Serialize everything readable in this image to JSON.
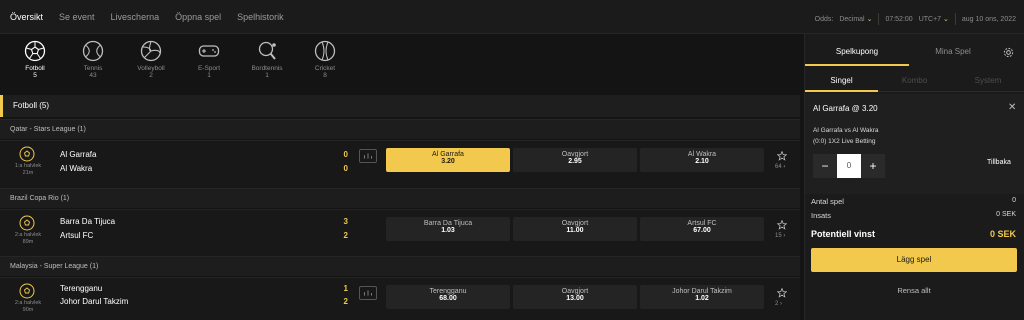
{
  "nav": [
    "Översikt",
    "Se event",
    "Livescherna",
    "Öppna spel",
    "Spelhistorik"
  ],
  "topbar": {
    "odds_label": "Odds:",
    "odds_value": "Decimal",
    "time": "07:52:00",
    "timezone": "UTC+7",
    "date": "aug 10 ons, 2022"
  },
  "sports": [
    {
      "name": "Fotboll",
      "count": "5",
      "icon": "football-icon"
    },
    {
      "name": "Tennis",
      "count": "43",
      "icon": "tennis-icon"
    },
    {
      "name": "Volleyboll",
      "count": "2",
      "icon": "volleyball-icon"
    },
    {
      "name": "E-Sport",
      "count": "1",
      "icon": "gamepad-icon"
    },
    {
      "name": "Bordtennis",
      "count": "1",
      "icon": "table-tennis-icon"
    },
    {
      "name": "Cricket",
      "count": "8",
      "icon": "cricket-icon"
    }
  ],
  "section": {
    "title": "Fotboll",
    "count": "(5)"
  },
  "leagues": [
    {
      "name": "Qatar - Stars League (1)",
      "match": {
        "period": "1:a halvlek",
        "minute": "21m",
        "home": "Al Garrafa",
        "away": "Al Wakra",
        "home_score": "0",
        "away_score": "0",
        "odds": [
          {
            "label": "Al Garrafa",
            "value": "3.20",
            "selected": true
          },
          {
            "label": "Oavgjort",
            "value": "2.95",
            "selected": false
          },
          {
            "label": "Al Wakra",
            "value": "2.10",
            "selected": false
          }
        ],
        "more": "64"
      }
    },
    {
      "name": "Brazil Copa Rio (1)",
      "match": {
        "period": "2:a halvlek",
        "minute": "89m",
        "home": "Barra Da Tijuca",
        "away": "Artsul FC",
        "home_score": "3",
        "away_score": "2",
        "odds": [
          {
            "label": "Barra Da Tijuca",
            "value": "1.03",
            "selected": false
          },
          {
            "label": "Oavgjort",
            "value": "11.00",
            "selected": false
          },
          {
            "label": "Artsul FC",
            "value": "67.00",
            "selected": false
          }
        ],
        "more": "15"
      }
    },
    {
      "name": "Malaysia - Super League (1)",
      "match": {
        "period": "2:a halvlek",
        "minute": "90m",
        "home": "Terengganu",
        "away": "Johor Darul Takzim",
        "home_score": "1",
        "away_score": "2",
        "odds": [
          {
            "label": "Terengganu",
            "value": "68.00",
            "selected": false
          },
          {
            "label": "Oavgjort",
            "value": "13.00",
            "selected": false
          },
          {
            "label": "Johor Darul Takzim",
            "value": "1.02",
            "selected": false
          }
        ],
        "more": "2"
      }
    }
  ],
  "panel": {
    "tab_active": "Spelkupong",
    "tab_inactive": "Mina Spel",
    "subtabs": [
      "Singel",
      "Kombo",
      "System"
    ],
    "selection_title": "Al Garrafa @ 3.20",
    "match_name": "Al Garrafa vs Al Wakra",
    "market": "(0:0) 1X2 Live Betting",
    "stake": "0",
    "back_label": "Tillbaka",
    "count_label": "Antal spel",
    "count_value": "0",
    "stake_label": "Insats",
    "stake_value": "0 SEK",
    "win_label": "Potentiell vinst",
    "win_value": "0 SEK",
    "place_button": "Lägg spel",
    "clear_button": "Rensa allt"
  },
  "colors": {
    "accent": "#f2c94c",
    "background": "#141414"
  }
}
